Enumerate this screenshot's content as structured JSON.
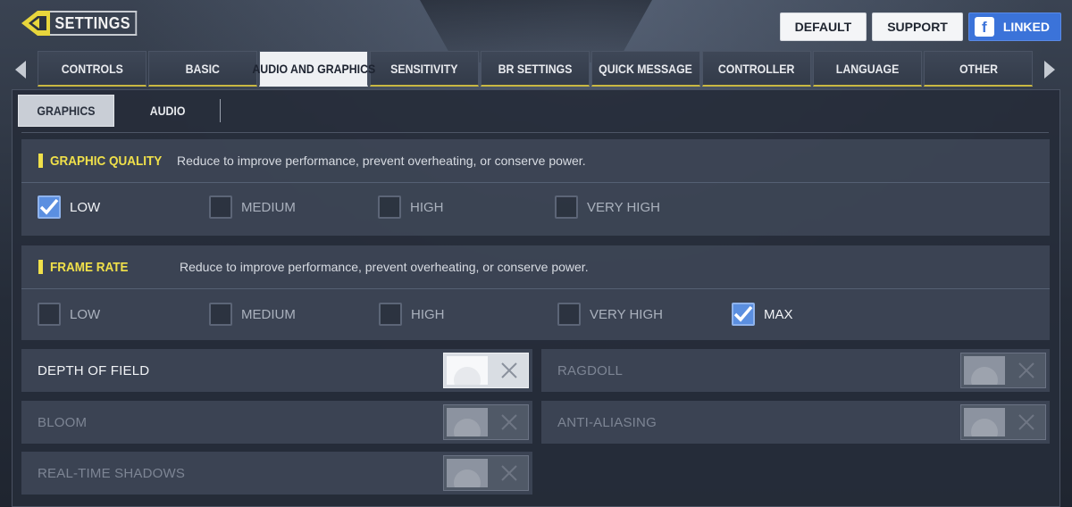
{
  "header": {
    "title": "SETTINGS",
    "buttons": {
      "default": "DEFAULT",
      "support": "SUPPORT",
      "linked": "LINKED"
    }
  },
  "tabs": [
    {
      "label": "CONTROLS",
      "active": false
    },
    {
      "label": "BASIC",
      "active": false
    },
    {
      "label": "AUDIO AND GRAPHICS",
      "active": true
    },
    {
      "label": "SENSITIVITY",
      "active": false
    },
    {
      "label": "BR SETTINGS",
      "active": false
    },
    {
      "label": "QUICK MESSAGE",
      "active": false
    },
    {
      "label": "CONTROLLER",
      "active": false
    },
    {
      "label": "LANGUAGE",
      "active": false
    },
    {
      "label": "OTHER",
      "active": false
    }
  ],
  "subtabs": {
    "graphics": "GRAPHICS",
    "audio": "AUDIO"
  },
  "graphic_quality": {
    "title": "GRAPHIC QUALITY",
    "description": "Reduce to improve performance, prevent overheating, or conserve power.",
    "options": [
      "LOW",
      "MEDIUM",
      "HIGH",
      "VERY HIGH"
    ],
    "selected": "LOW"
  },
  "frame_rate": {
    "title": "FRAME RATE",
    "description": "Reduce to improve performance, prevent overheating, or conserve power.",
    "options": [
      "LOW",
      "MEDIUM",
      "HIGH",
      "VERY HIGH",
      "MAX"
    ],
    "selected": "MAX"
  },
  "toggles": {
    "depth_of_field": "DEPTH OF FIELD",
    "ragdoll": "RAGDOLL",
    "bloom": "BLOOM",
    "anti_aliasing": "ANTI-ALIASING",
    "real_time_shadows": "REAL-TIME SHADOWS"
  },
  "colors": {
    "accent": "#f0e04a",
    "check": "#5b8fe0",
    "facebook": "#3b73d9"
  }
}
